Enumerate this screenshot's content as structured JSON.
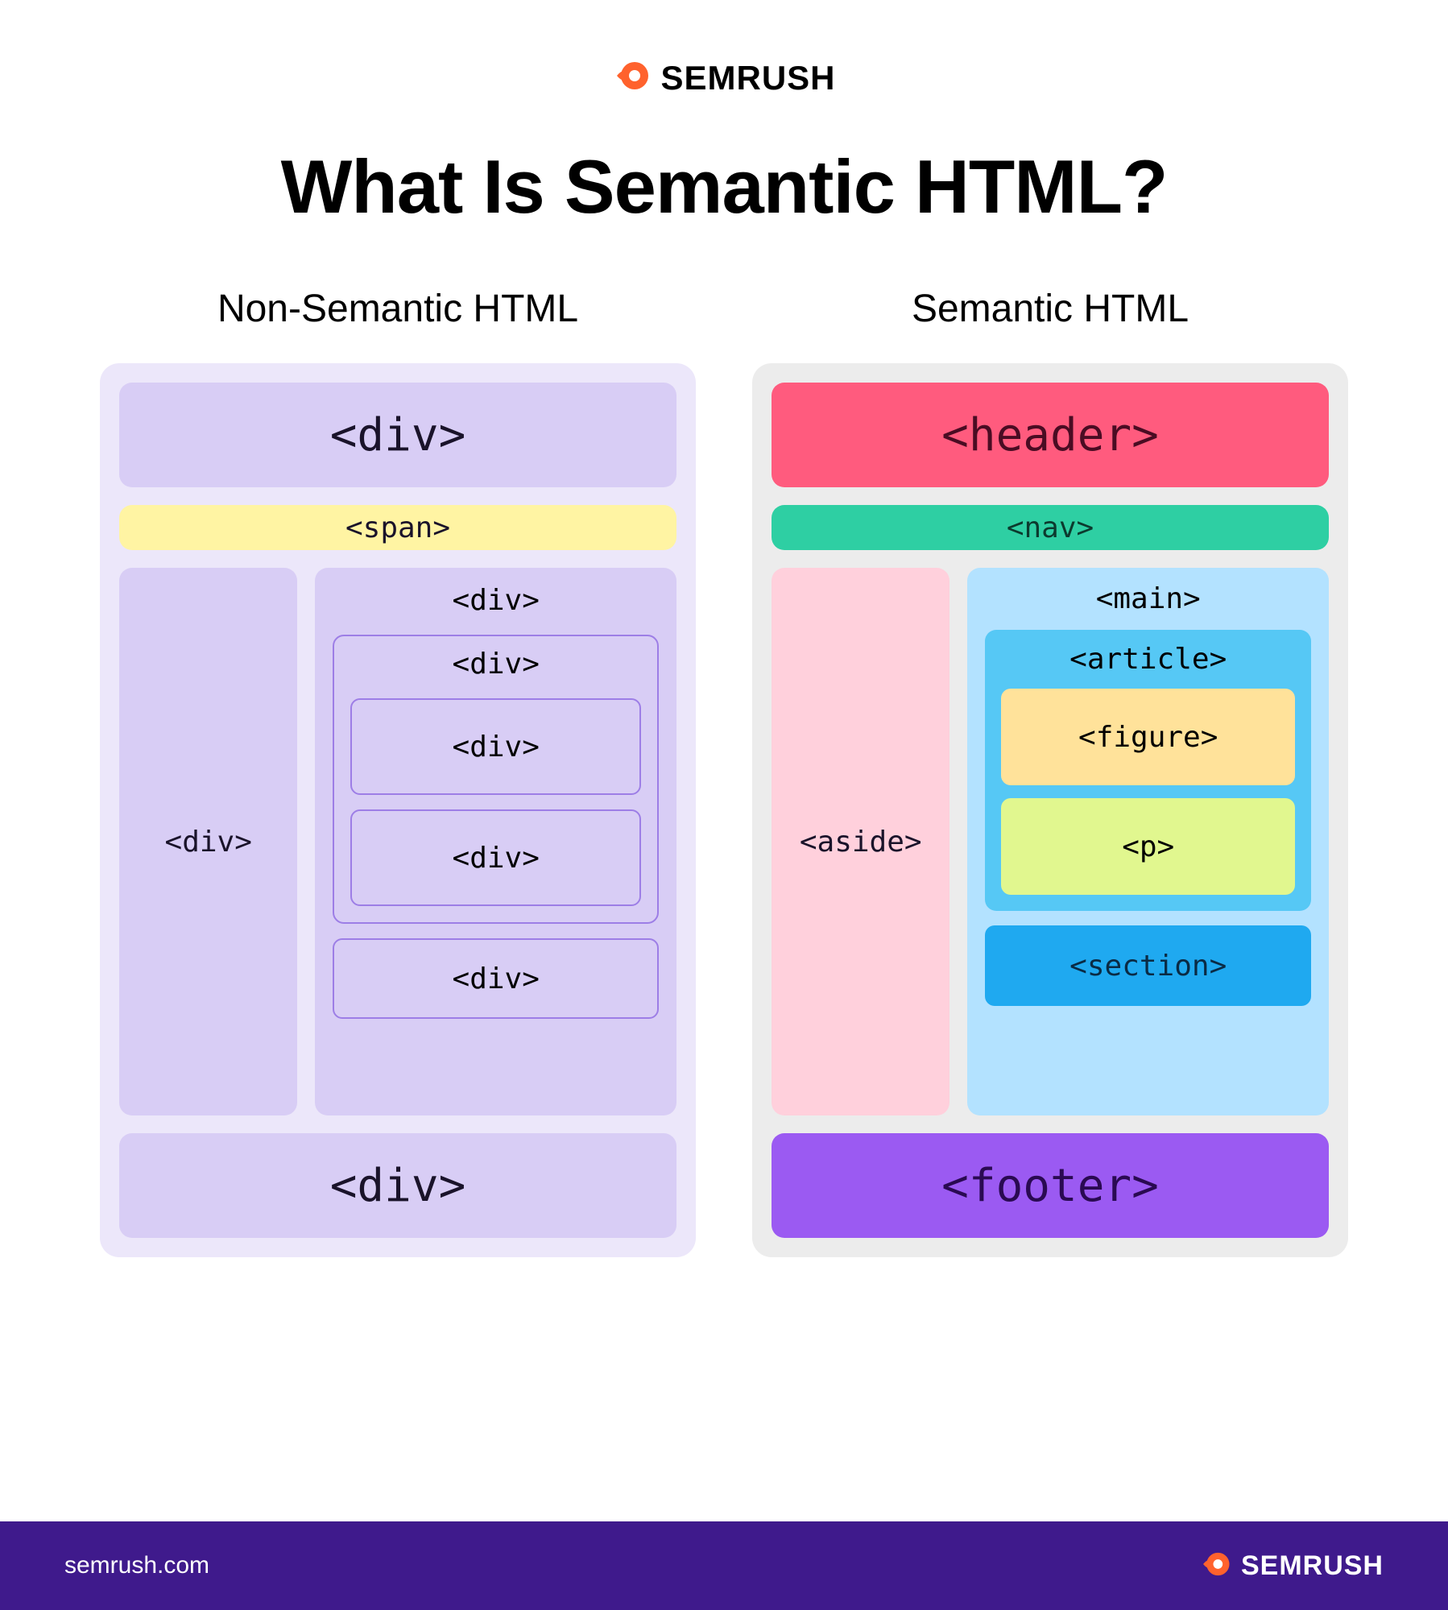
{
  "brand": "SEMRUSH",
  "title": "What Is Semantic HTML?",
  "columns": {
    "left": {
      "title": "Non-Semantic HTML",
      "header": "<div>",
      "nav": "<span>",
      "aside": "<div>",
      "main": "<div>",
      "article": "<div>",
      "figure": "<div>",
      "para": "<div>",
      "section": "<div>",
      "footer": "<div>"
    },
    "right": {
      "title": "Semantic HTML",
      "header": "<header>",
      "nav": "<nav>",
      "aside": "<aside>",
      "main": "<main>",
      "article": "<article>",
      "figure": "<figure>",
      "para": "<p>",
      "section": "<section>",
      "footer": "<footer>"
    }
  },
  "footer": {
    "url": "semrush.com",
    "brand": "SEMRUSH"
  }
}
